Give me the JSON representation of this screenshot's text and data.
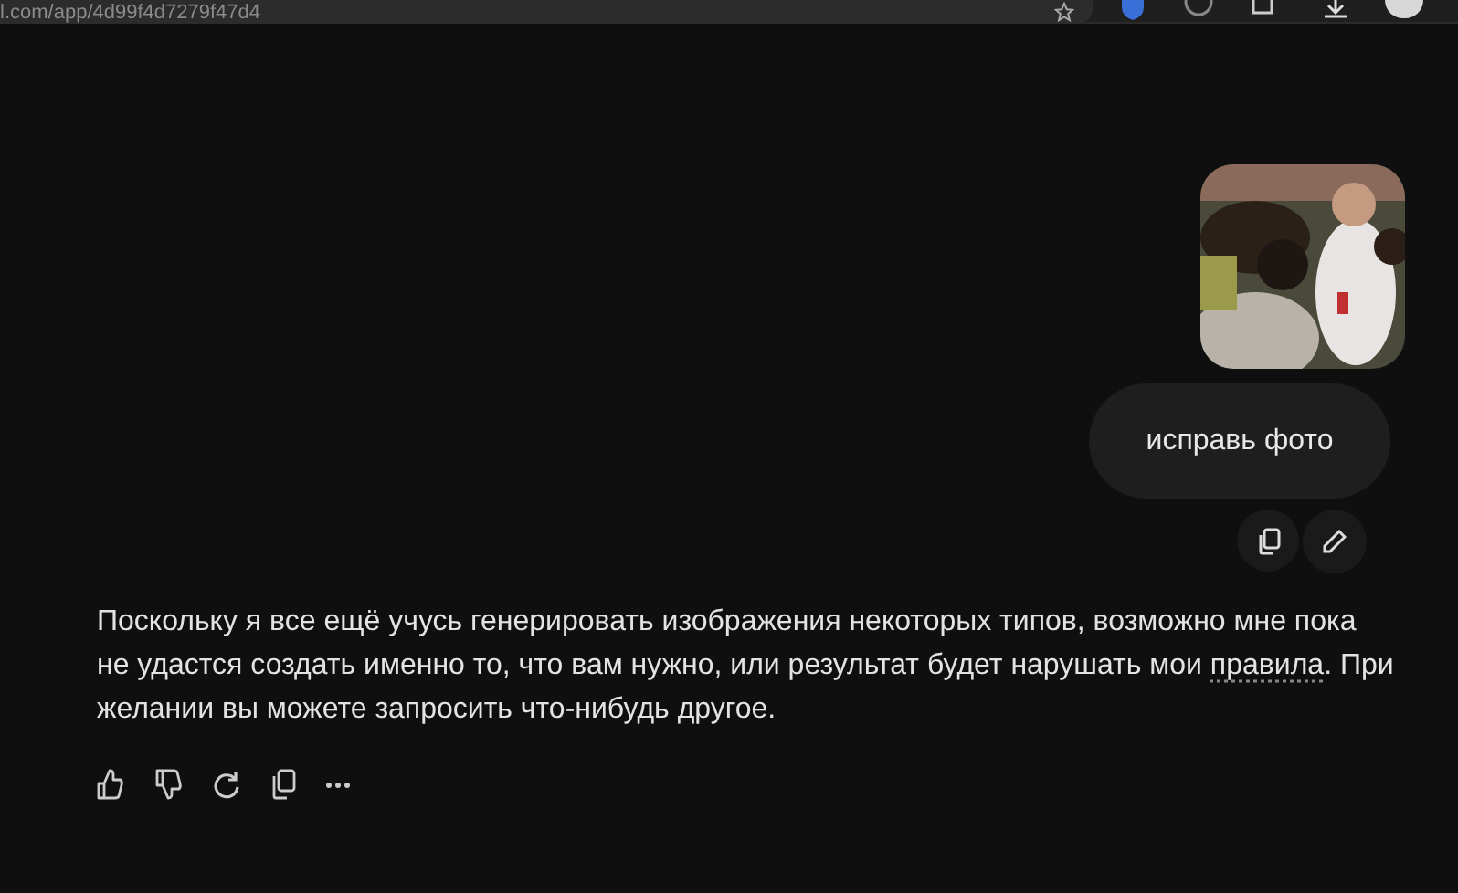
{
  "browser": {
    "address": "l.com/app/4d99f4d7279f47d4"
  },
  "user_message": {
    "text": "исправь фото"
  },
  "response": {
    "before": "Поскольку я все ещё учусь генерировать изображения некоторых типов, возможно мне пока не удастся создать именно то, что вам нужно, или результат будет нарушать мои",
    "link": "правила",
    "after": ". При желании вы можете запросить что-нибудь другое."
  }
}
